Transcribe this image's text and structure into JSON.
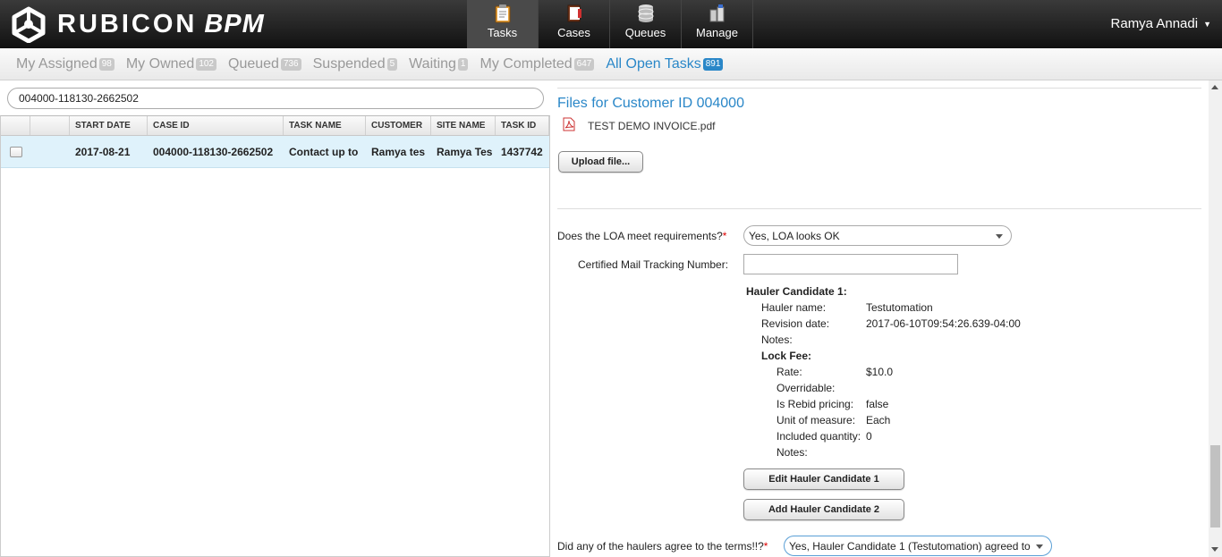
{
  "app": {
    "logo_word": "RUBICON",
    "logo_suffix": "BPM",
    "user_name": "Ramya Annadi"
  },
  "nav": [
    {
      "label": "Tasks",
      "icon": "clipboard-icon",
      "active": true
    },
    {
      "label": "Cases",
      "icon": "binder-icon",
      "active": false
    },
    {
      "label": "Queues",
      "icon": "database-icon",
      "active": false
    },
    {
      "label": "Manage",
      "icon": "manage-icon",
      "active": false
    }
  ],
  "filters": [
    {
      "label": "My Assigned",
      "count": "98"
    },
    {
      "label": "My Owned",
      "count": "102"
    },
    {
      "label": "Queued",
      "count": "736"
    },
    {
      "label": "Suspended",
      "count": "5"
    },
    {
      "label": "Waiting",
      "count": "1"
    },
    {
      "label": "My Completed",
      "count": "647"
    },
    {
      "label": "All Open Tasks",
      "count": "891",
      "active": true
    }
  ],
  "search": {
    "value": "004000-118130-2662502"
  },
  "grid": {
    "columns": [
      "",
      "",
      "START DATE",
      "CASE ID",
      "TASK NAME",
      "CUSTOMER",
      "SITE NAME",
      "TASK ID"
    ],
    "rows": [
      {
        "start_date": "2017-08-21",
        "case_id": "004000-118130-2662502",
        "task_name": "Contact up to",
        "customer": "Ramya tes",
        "site_name": "Ramya Tes",
        "task_id": "1437742"
      }
    ]
  },
  "files": {
    "title": "Files for Customer ID 004000",
    "file_name": "TEST DEMO INVOICE.pdf",
    "upload_label": "Upload file..."
  },
  "form": {
    "loa_label": "Does the LOA meet requirements?",
    "loa_value": "Yes, LOA looks OK",
    "tracking_label": "Certified Mail Tracking Number:",
    "tracking_value": "",
    "required_mark": "*",
    "hauler_heading": "Hauler Candidate 1:",
    "hauler_name_label": "Hauler name:",
    "hauler_name_value": "Testutomation",
    "revision_label": "Revision date:",
    "revision_value": "2017-06-10T09:54:26.639-04:00",
    "notes_label": "Notes:",
    "lock_fee_heading": "Lock Fee:",
    "rate_label": "Rate:",
    "rate_value": "$10.0",
    "overridable_label": "Overridable:",
    "rebid_label": "Is Rebid pricing:",
    "rebid_value": "false",
    "unit_label": "Unit of measure:",
    "unit_value": "Each",
    "included_label": "Included quantity:",
    "included_value": "0",
    "notes2_label": "Notes:",
    "edit_button": "Edit Hauler Candidate 1",
    "add_button": "Add Hauler Candidate 2",
    "agree_label": "Did any of the haulers agree to the terms!!?",
    "agree_value": "Yes, Hauler Candidate 1 (Testutomation) agreed to"
  },
  "colors": {
    "accent": "#2a87c8",
    "selected_row": "#dff2fb",
    "topbar": "#1a1a1a"
  }
}
